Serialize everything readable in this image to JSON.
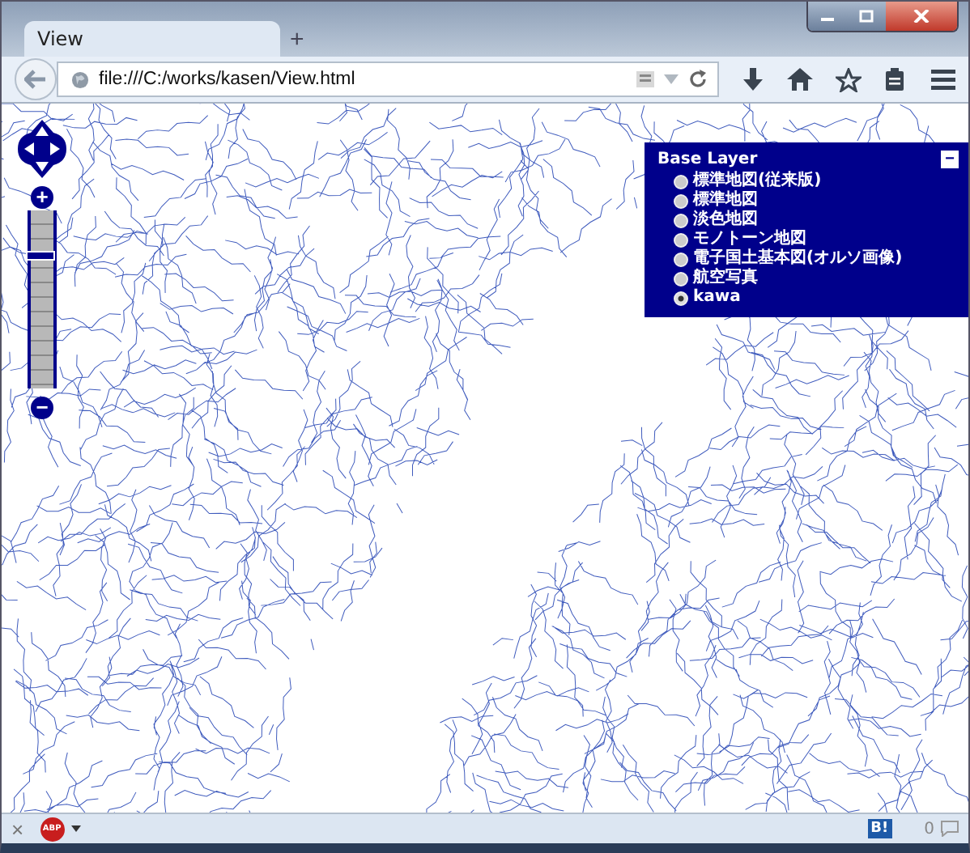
{
  "tab": {
    "title": "View"
  },
  "new_tab": "+",
  "address_bar": {
    "url": "file:///C:/works/kasen/View.html"
  },
  "map": {
    "zoom": {
      "in": "+",
      "out": "−",
      "level": 0.75
    },
    "layer_switcher": {
      "title": "Base Layer",
      "minimize": "−",
      "layers": [
        {
          "label": "標準地図(従来版)",
          "selected": false
        },
        {
          "label": "標準地図",
          "selected": false
        },
        {
          "label": "淡色地図",
          "selected": false
        },
        {
          "label": "モノトーン地図",
          "selected": false
        },
        {
          "label": "電子国土基本図(オルソ画像)",
          "selected": false
        },
        {
          "label": "航空写真",
          "selected": false
        },
        {
          "label": "kawa",
          "selected": true
        }
      ]
    }
  },
  "status_bar": {
    "close": "×",
    "adblock": "ABP",
    "bookmark": "B!",
    "count": "0"
  }
}
